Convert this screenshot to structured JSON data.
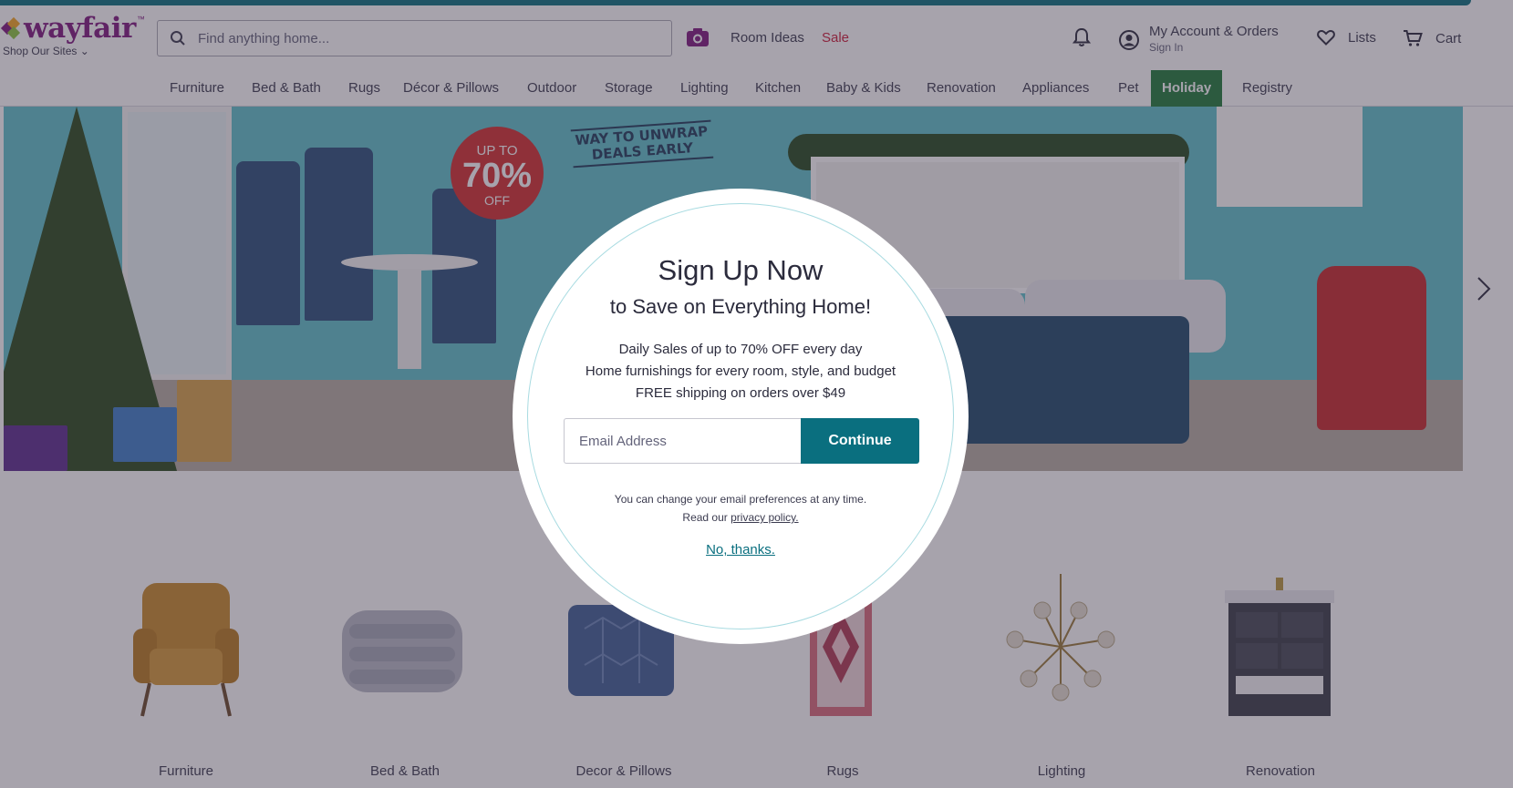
{
  "brand": {
    "logo_text": "wayfair",
    "shop_sites": "Shop Our Sites ⌄"
  },
  "header": {
    "search_placeholder": "Find anything home...",
    "room_ideas": "Room Ideas",
    "sale": "Sale",
    "account_main": "My Account & Orders",
    "account_sub": "Sign In",
    "lists": "Lists",
    "cart": "Cart"
  },
  "nav": {
    "items": [
      "Furniture",
      "Bed & Bath",
      "Rugs",
      "Décor & Pillows",
      "Outdoor",
      "Storage",
      "Lighting",
      "Kitchen",
      "Baby & Kids",
      "Renovation",
      "Appliances",
      "Pet",
      "Holiday",
      "Registry"
    ]
  },
  "hero": {
    "badge_upto": "UP TO",
    "badge_pct": "70%",
    "badge_off": "OFF",
    "tagline_1": "WAY TO UNWRAP",
    "tagline_2": "DEALS EARLY"
  },
  "categories": [
    "Furniture",
    "Bed & Bath",
    "Decor & Pillows",
    "Rugs",
    "Lighting",
    "Renovation"
  ],
  "modal": {
    "title": "Sign Up Now",
    "subtitle": "to Save on Everything Home!",
    "benefit_1": "Daily Sales of up to 70% OFF every day",
    "benefit_2": "Home furnishings for every room, style, and budget",
    "benefit_3": "FREE shipping on orders over $49",
    "email_placeholder": "Email Address",
    "continue_label": "Continue",
    "fine_print_1": "You can change your email preferences at any time.",
    "fine_print_2_prefix": "Read our ",
    "privacy_link": "privacy policy.",
    "no_thanks": "No, thanks."
  },
  "colors": {
    "brand_purple": "#7f187f",
    "accent_teal": "#0a6f7f",
    "sale_red": "#cc1c39",
    "holiday_green": "#1f7a3a"
  },
  "icons": [
    "search-icon",
    "camera-icon",
    "bell-icon",
    "account-icon",
    "heart-icon",
    "cart-icon",
    "chevron-right-icon"
  ]
}
